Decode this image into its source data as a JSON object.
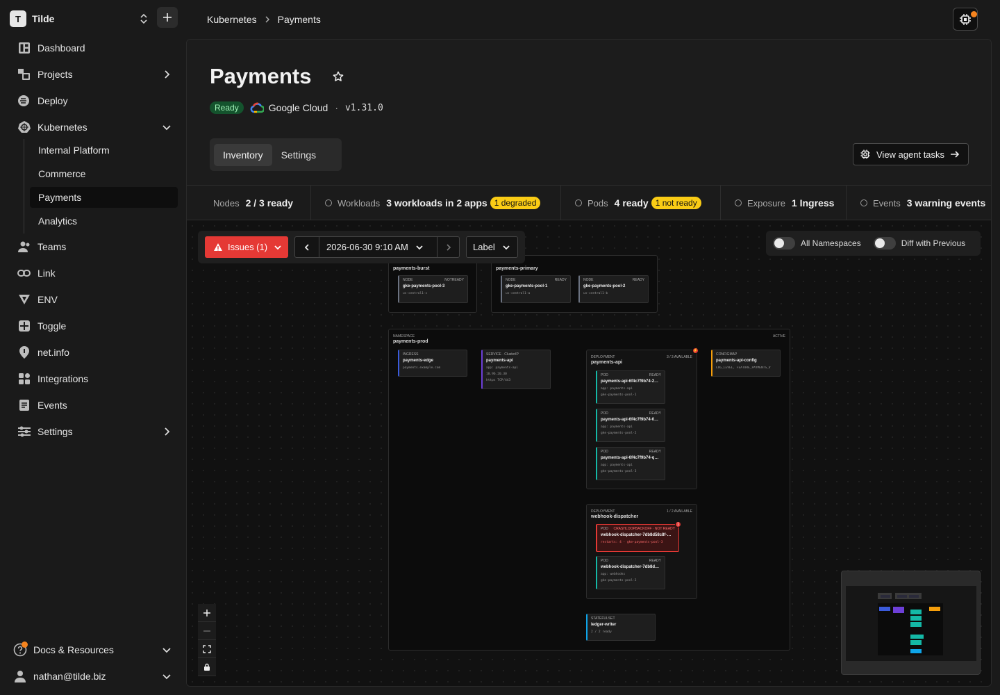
{
  "workspace": {
    "initial": "T",
    "name": "Tilde"
  },
  "sidebar": {
    "items": [
      {
        "label": "Dashboard"
      },
      {
        "label": "Projects"
      },
      {
        "label": "Deploy"
      },
      {
        "label": "Kubernetes"
      },
      {
        "label": "Teams"
      },
      {
        "label": "Link"
      },
      {
        "label": "ENV"
      },
      {
        "label": "Toggle"
      },
      {
        "label": "net.info"
      },
      {
        "label": "Integrations"
      },
      {
        "label": "Events"
      },
      {
        "label": "Settings"
      }
    ],
    "kubernetes_children": [
      {
        "label": "Internal Platform"
      },
      {
        "label": "Commerce"
      },
      {
        "label": "Payments"
      },
      {
        "label": "Analytics"
      }
    ],
    "docs_label": "Docs & Resources",
    "user_email": "nathan@tilde.biz"
  },
  "breadcrumb": [
    "Kubernetes",
    "Payments"
  ],
  "cluster": {
    "title": "Payments",
    "status": "Ready",
    "provider": "Google Cloud",
    "version": "v1.31.0",
    "status_color": "#14532d"
  },
  "tabs": [
    {
      "label": "Inventory"
    },
    {
      "label": "Settings"
    }
  ],
  "view_agent_tasks_label": "View agent tasks",
  "stats": [
    {
      "label": "Nodes",
      "value": "2 / 3 ready",
      "badge": ""
    },
    {
      "label": "Workloads",
      "value": "3 workloads in 2 apps",
      "badge": "1 degraded"
    },
    {
      "label": "Pods",
      "value": "4 ready",
      "badge": "1 not ready"
    },
    {
      "label": "Exposure",
      "value": "1 Ingress",
      "badge": ""
    },
    {
      "label": "Events",
      "value": "3 warning events",
      "badge": ""
    }
  ],
  "toolbar": {
    "issues_label": "Issues (1)",
    "timestamp": "2026-06-30 9:10 AM",
    "label_select": "Label",
    "all_namespaces": "All Namespaces",
    "diff_previous": "Diff with Previous"
  },
  "graph": {
    "pools": [
      {
        "title": "payments-burst",
        "nodes": [
          {
            "kind": "NODE",
            "status": "NOTREADY",
            "name": "gke-payments-pool-3",
            "zone": "us-central1-c"
          }
        ]
      },
      {
        "title": "payments-primary",
        "nodes": [
          {
            "kind": "NODE",
            "status": "READY",
            "name": "gke-payments-pool-1",
            "zone": "us-central1-a"
          },
          {
            "kind": "NODE",
            "status": "READY",
            "name": "gke-payments-pool-2",
            "zone": "us-central1-b"
          }
        ]
      }
    ],
    "namespace": {
      "kind": "NAMESPACE",
      "name": "payments-prod",
      "status": "ACTIVE"
    },
    "ingress": {
      "kind": "INGRESS",
      "name": "payments-edge",
      "host": "payments.example.com"
    },
    "service": {
      "kind": "SERVICE · ClusterIP",
      "name": "payments-api",
      "selector": "app: payments-api",
      "ip": "10.96.20.30",
      "port": "https TCP/443"
    },
    "configmap": {
      "kind": "CONFIGMAP",
      "name": "payments-api-config",
      "keys": "LOG_LEVEL, FEATURE_PAYMENTS_V"
    },
    "deployments": [
      {
        "kind": "DEPLOYMENT",
        "name": "payments-api",
        "status": "3 / 3 AVAILABLE",
        "badge": "⚡",
        "pods": [
          {
            "kind": "POD",
            "status": "READY",
            "name": "payments-api-6f4c7f9b74-2…",
            "label": "app: payments-api",
            "node": "gke-payments-pool-1"
          },
          {
            "kind": "POD",
            "status": "READY",
            "name": "payments-api-6f4c7f9b74-0…",
            "label": "app: payments-api",
            "node": "gke-payments-pool-2"
          },
          {
            "kind": "POD",
            "status": "READY",
            "name": "payments-api-6f4c7f9b74-q…",
            "label": "app: payments-api",
            "node": "gke-payments-pool-3"
          }
        ]
      },
      {
        "kind": "DEPLOYMENT",
        "name": "webhook-dispatcher",
        "status": "1 / 2 AVAILABLE",
        "pods": [
          {
            "kind": "POD",
            "status": "CRASHLOOPBACKOFF · NOT READY",
            "name": "webhook-dispatcher-7db8d58c8f-…",
            "label": "restarts: 4 · gke-payments-pool-3",
            "badge": "1"
          },
          {
            "kind": "POD",
            "status": "READY",
            "name": "webhook-dispatcher-7db8d…",
            "label": "app: webhooks",
            "node": "gke-payments-pool-2"
          }
        ]
      }
    ],
    "statefulset": {
      "kind": "STATEFULSET",
      "name": "ledger-writer",
      "status": "2 / 2 ready"
    }
  }
}
